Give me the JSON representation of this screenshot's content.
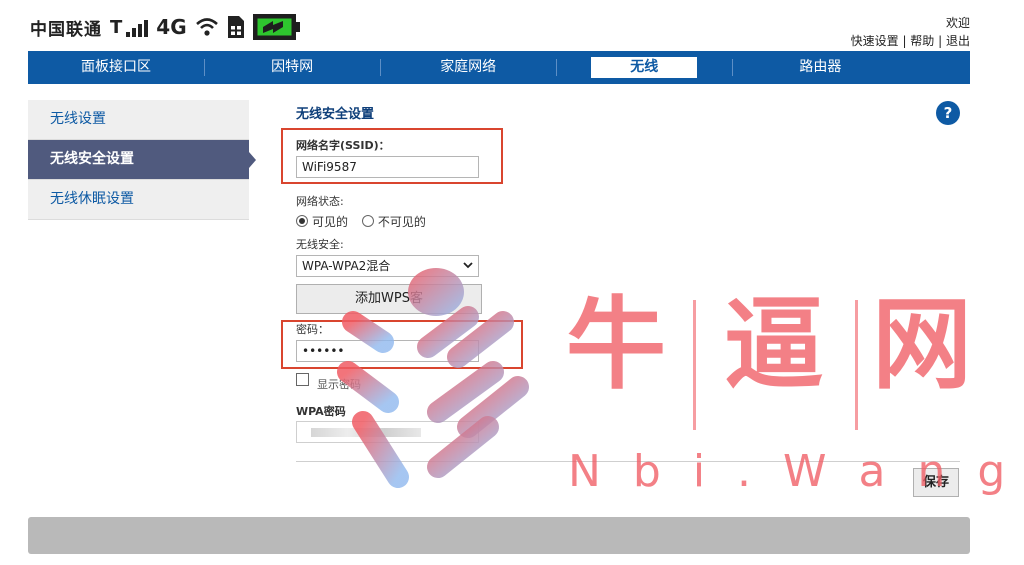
{
  "header": {
    "carrier": "中国联通",
    "network": "4G",
    "welcome": "欢迎",
    "links": [
      "快速设置",
      "帮助",
      "退出"
    ],
    "link_sep": " | "
  },
  "nav": {
    "items": [
      "面板接口区",
      "因特网",
      "家庭网络",
      "无线",
      "路由器"
    ],
    "active": "无线"
  },
  "sidebar": {
    "items": [
      "无线设置",
      "无线安全设置",
      "无线休眠设置"
    ],
    "active": "无线安全设置"
  },
  "form": {
    "title": "无线安全设置",
    "ssid_label": "网络名字(SSID)：",
    "ssid_value": "WiFi9587",
    "status_label": "网络状态:",
    "visible_label": "可见的",
    "invisible_label": "不可见的",
    "security_label": "无线安全:",
    "security_value": "WPA-WPA2混合",
    "wps_button": "添加WPS客",
    "password_label": "密码：",
    "password_value": "••••••",
    "show_password_label": "显示密码",
    "wpa_key_label": "WPA密码",
    "save_button": "保存"
  },
  "watermark": {
    "title": [
      "牛",
      "逼",
      "网"
    ],
    "subtitle": "N b i . W a n g"
  },
  "colors": {
    "nav_blue": "#0e5aa4",
    "sidebar_active": "#505a7e",
    "highlight_red": "#d9452f",
    "watermark": "#f05c64"
  }
}
